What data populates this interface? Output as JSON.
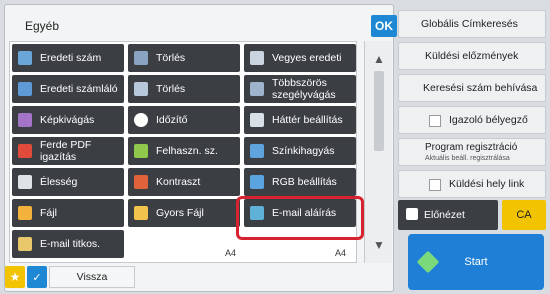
{
  "panel": {
    "title": "Egyéb",
    "ok_label": "OK",
    "buttons": [
      {
        "label": "Eredeti szám",
        "icon": "document-icon",
        "icon_color": "#6aa6d8"
      },
      {
        "label": "Törlés",
        "icon": "erase-icon",
        "icon_color": "#8aa3c2"
      },
      {
        "label": "Vegyes eredeti",
        "icon": "mixed-original-icon",
        "icon_color": "#c9d4e0"
      },
      {
        "label": "Eredeti számláló",
        "icon": "counter-icon",
        "icon_color": "#5f99d6"
      },
      {
        "label": "Törlés",
        "icon": "erase-icon",
        "icon_color": "#b8c8dc"
      },
      {
        "label": "Többszörös szegélyvágás",
        "icon": "multi-crop-icon",
        "icon_color": "#9fb4cc"
      },
      {
        "label": "Képkivágás",
        "icon": "crop-icon",
        "icon_color": "#a474c9"
      },
      {
        "label": "Időzítő",
        "icon": "clock-icon",
        "icon_color": "#ffffff"
      },
      {
        "label": "Háttér beállítás",
        "icon": "background-icon",
        "icon_color": "#d9dfe6"
      },
      {
        "label": "Ferde PDF igazítás",
        "icon": "pdf-skew-icon",
        "icon_color": "#e14b3b"
      },
      {
        "label": "Felhaszn. sz.",
        "icon": "user-number-icon",
        "icon_color": "#8fc84a"
      },
      {
        "label": "Színkihagyás",
        "icon": "color-drop-icon",
        "icon_color": "#5fa3dd"
      },
      {
        "label": "Élesség",
        "icon": "sharpness-icon",
        "icon_color": "#dfe3e8"
      },
      {
        "label": "Kontraszt",
        "icon": "contrast-icon",
        "icon_color": "#e0623b"
      },
      {
        "label": "RGB beállítás",
        "icon": "rgb-icon",
        "icon_color": "#5aa5e0"
      },
      {
        "label": "Fájl",
        "icon": "folder-icon",
        "icon_color": "#f3b23b"
      },
      {
        "label": "Gyors Fájl",
        "icon": "quick-file-icon",
        "icon_color": "#f3c44b"
      },
      {
        "label": "E-mail aláírás",
        "icon": "email-signature-icon",
        "icon_color": "#5fb1d8"
      },
      {
        "label": "E-mail titkos.",
        "icon": "email-encrypt-icon",
        "icon_color": "#e9c86b"
      }
    ],
    "bottom": {
      "back_label": "Vissza",
      "paper1": "A4",
      "paper2": "A4"
    }
  },
  "side": {
    "items": [
      "Globális Címkeresés",
      "Küldési előzmények",
      "Keresési szám behívása",
      "Igazoló bélyegző",
      "Program regisztráció",
      "Küldési hely link"
    ],
    "program_sub": "Aktuális beáll. regisztrálása",
    "preview_label": "Előnézet",
    "ca_label": "CA",
    "start_label": "Start"
  },
  "colors": {
    "accent_blue": "#1e88d4",
    "highlight_red": "#d6232f",
    "ca_yellow": "#f2c300",
    "dark_button": "#3b3f44"
  }
}
